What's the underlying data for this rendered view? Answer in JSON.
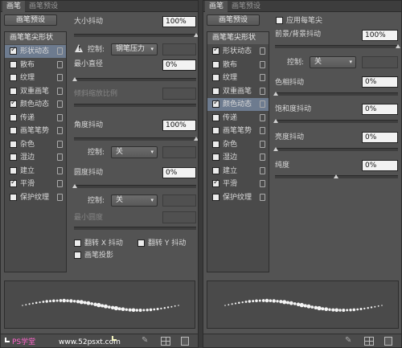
{
  "left": {
    "tabs": [
      "画笔",
      "画笔预设"
    ],
    "preset_button": "画笔预设",
    "sidebar_header": "画笔笔尖形状",
    "items": [
      {
        "label": "形状动态",
        "checked": true,
        "selected": true
      },
      {
        "label": "散布",
        "checked": false,
        "selected": false
      },
      {
        "label": "纹理",
        "checked": false,
        "selected": false
      },
      {
        "label": "双重画笔",
        "checked": false,
        "selected": false
      },
      {
        "label": "颜色动态",
        "checked": true,
        "selected": false
      },
      {
        "label": "传递",
        "checked": false,
        "selected": false
      },
      {
        "label": "画笔笔势",
        "checked": false,
        "selected": false
      },
      {
        "label": "杂色",
        "checked": false,
        "selected": false
      },
      {
        "label": "湿边",
        "checked": false,
        "selected": false
      },
      {
        "label": "建立",
        "checked": false,
        "selected": false
      },
      {
        "label": "平滑",
        "checked": true,
        "selected": false
      },
      {
        "label": "保护纹理",
        "checked": false,
        "selected": false
      }
    ],
    "size_jitter": {
      "label": "大小抖动",
      "value": "100%",
      "level": 1.0
    },
    "control1": {
      "label": "控制:",
      "value": "钢笔压力"
    },
    "min_diameter": {
      "label": "最小直径",
      "value": "0%",
      "level": 0.0
    },
    "tilt_scale": {
      "label": "倾斜缩放比例"
    },
    "angle_jitter": {
      "label": "角度抖动",
      "value": "100%",
      "level": 1.0
    },
    "control2": {
      "label": "控制:",
      "value": "关"
    },
    "roundness_jitter": {
      "label": "圆度抖动",
      "value": "0%",
      "level": 0.0
    },
    "control3": {
      "label": "控制:",
      "value": "关"
    },
    "min_roundness": {
      "label": "最小圆度"
    },
    "flip_x": "翻转 X 抖动",
    "flip_y": "翻转 Y 抖动",
    "brush_projection": "画笔投影"
  },
  "right": {
    "tabs": [
      "画笔",
      "画笔预设"
    ],
    "preset_button": "画笔预设",
    "sidebar_header": "画笔笔尖形状",
    "items": [
      {
        "label": "形状动态",
        "checked": true,
        "selected": false
      },
      {
        "label": "散布",
        "checked": false,
        "selected": false
      },
      {
        "label": "纹理",
        "checked": false,
        "selected": false
      },
      {
        "label": "双重画笔",
        "checked": false,
        "selected": false
      },
      {
        "label": "颜色动态",
        "checked": true,
        "selected": true
      },
      {
        "label": "传递",
        "checked": false,
        "selected": false
      },
      {
        "label": "画笔笔势",
        "checked": false,
        "selected": false
      },
      {
        "label": "杂色",
        "checked": false,
        "selected": false
      },
      {
        "label": "湿边",
        "checked": false,
        "selected": false
      },
      {
        "label": "建立",
        "checked": false,
        "selected": false
      },
      {
        "label": "平滑",
        "checked": true,
        "selected": false
      },
      {
        "label": "保护纹理",
        "checked": false,
        "selected": false
      }
    ],
    "apply_per_tip": "应用每笔尖",
    "fg_bg_jitter": {
      "label": "前景/背景抖动",
      "value": "100%",
      "level": 1.0
    },
    "control": {
      "label": "控制:",
      "value": "关"
    },
    "hue_jitter": {
      "label": "色相抖动",
      "value": "0%",
      "level": 0.0
    },
    "saturation_jitter": {
      "label": "饱和度抖动",
      "value": "0%",
      "level": 0.0
    },
    "brightness_jitter": {
      "label": "亮度抖动",
      "value": "0%",
      "level": 0.0
    },
    "purity": {
      "label": "纯度",
      "value": "0%",
      "level": 0.5
    }
  },
  "watermark": {
    "left": "PS学堂",
    "center": "www.52psxt.com"
  },
  "icons": [
    "lock-icon",
    "warning-icon",
    "dropdown-arrow-icon",
    "brush-icon",
    "grid-icon",
    "new-preset-icon"
  ]
}
